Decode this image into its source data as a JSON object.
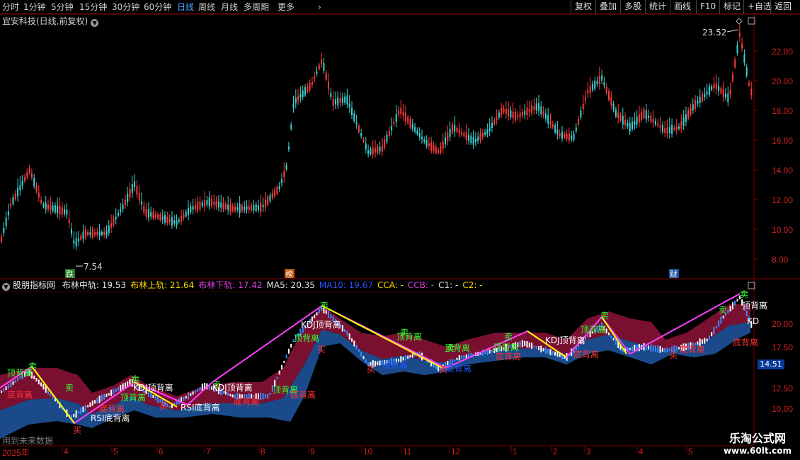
{
  "toolbar": {
    "periods": [
      "分时",
      "1分钟",
      "5分钟",
      "15分钟",
      "30分钟",
      "60分钟",
      "日线",
      "周线",
      "月线",
      "多周期",
      "更多"
    ],
    "active": "日线",
    "actions": [
      "复权",
      "叠加",
      "多股",
      "统计",
      "画线",
      "F10",
      "标记",
      "+自选",
      "返回"
    ]
  },
  "main": {
    "title": "宜安科技(日线,前复权)",
    "high_label": "23.52",
    "low_label": "7.54",
    "event_markers": [
      "跌",
      "榜",
      "财"
    ]
  },
  "indicator": {
    "name": "股朋指标网",
    "legend": [
      {
        "text": "布林中轨: 19.53",
        "color": "#e6e6e6"
      },
      {
        "text": "布林上轨: 21.64",
        "color": "#ffd700"
      },
      {
        "text": "布林下轨: 17.42",
        "color": "#e040e0"
      },
      {
        "text": "MA5: 20.35",
        "color": "#e6e6e6"
      },
      {
        "text": "MA10: 19.67",
        "color": "#3050ff"
      },
      {
        "text": "CCA: -",
        "color": "#ffd700"
      },
      {
        "text": "CCB: -",
        "color": "#e040e0"
      },
      {
        "text": "C1: -",
        "color": "#e6e6e6"
      },
      {
        "text": "C2: -",
        "color": "#ffd700"
      }
    ],
    "current_value": "14.51",
    "ghost_text": "用到未来数据"
  },
  "axis": {
    "price_ticks": [
      "22.00",
      "20.00",
      "18.00",
      "16.00",
      "14.00",
      "12.00",
      "10.00",
      "8.00"
    ],
    "indicator_ticks": [
      "20.00",
      "17.50",
      "12.50",
      "10.00"
    ],
    "dates": [
      "2025年",
      "4",
      "5",
      "6",
      "7",
      "8",
      "9",
      "10",
      "11",
      "12",
      "1",
      "2",
      "3",
      "4",
      "5"
    ]
  },
  "signals": {
    "sell": "卖",
    "buy": "买",
    "kdj_top": "KDJ顶背离",
    "rsi_bottom": "RSI底背离",
    "top_div": "顶背离",
    "bottom_div": "底背离",
    "kd": "KD"
  },
  "watermark": {
    "line1": "乐淘公式网",
    "line2": "www.60lt.com"
  },
  "colors": {
    "up": "#ff3b3b",
    "down": "#39d4d4",
    "grid": "#7a0000",
    "axis_text": "#cc2222",
    "ma_pink": "#ff40ff",
    "ma_yellow": "#ffff00",
    "band_red": "#7a1030",
    "band_blue": "#1a4a8a"
  }
}
